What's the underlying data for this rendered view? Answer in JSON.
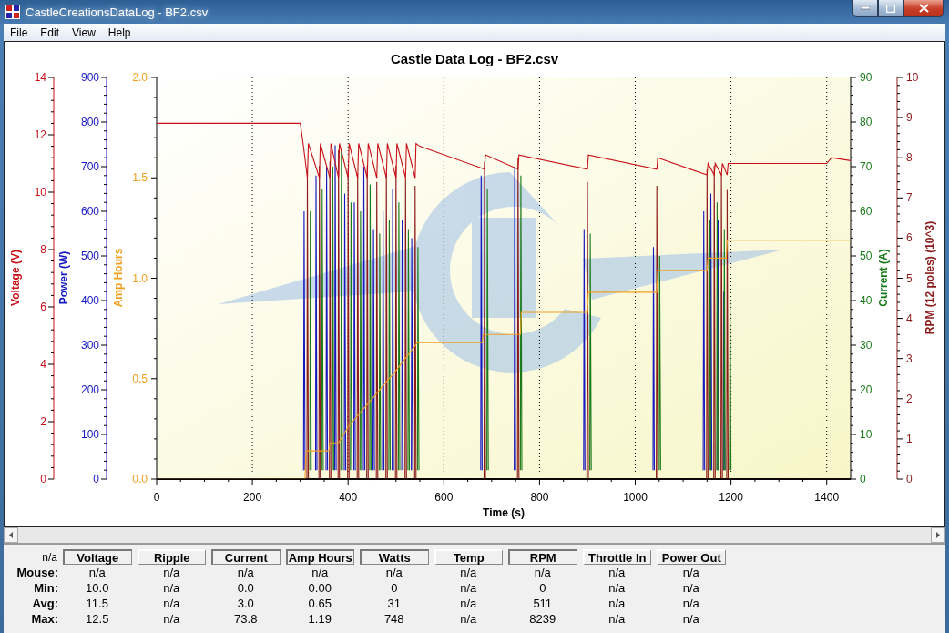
{
  "window": {
    "title": "CastleCreationsDataLog - BF2.csv"
  },
  "menu": [
    "File",
    "Edit",
    "View",
    "Help"
  ],
  "charts": [
    {
      "chart_data": {
        "type": "line",
        "title": "Castle Data Log - BF2.csv",
        "xlabel": "Time (s)",
        "ylabel": "Voltage (V)",
        "xlim": [
          0,
          1450
        ],
        "ylim": [
          0,
          14
        ],
        "xticks": [
          0,
          200,
          400,
          600,
          800,
          1000,
          1200,
          1400
        ],
        "yticks": [
          0,
          2,
          4,
          6,
          8,
          10,
          12,
          14
        ],
        "x": [
          0,
          300,
          306,
          315,
          317,
          340,
          342,
          362,
          364,
          380,
          382,
          400,
          402,
          420,
          422,
          440,
          442,
          460,
          462,
          480,
          482,
          500,
          502,
          520,
          522,
          540,
          542,
          550,
          685,
          687,
          755,
          757,
          900,
          902,
          1045,
          1047,
          1150,
          1152,
          1165,
          1167,
          1180,
          1182,
          1192,
          1194,
          1400,
          1410,
          1450
        ],
        "series": [
          {
            "color": "#c81018",
            "values": [
              12.4,
              12.4,
              11.7,
              10.5,
              11.7,
              10.5,
              11.7,
              10.5,
              11.7,
              10.5,
              11.7,
              10.5,
              11.7,
              10.5,
              11.7,
              10.5,
              11.7,
              10.5,
              11.7,
              10.5,
              11.7,
              10.5,
              11.7,
              10.5,
              11.7,
              10.5,
              11.7,
              11.6,
              10.8,
              11.3,
              10.8,
              11.3,
              10.8,
              11.3,
              10.8,
              11.2,
              10.6,
              11.0,
              10.6,
              11.0,
              10.6,
              11.0,
              10.6,
              11.0,
              11.0,
              11.2,
              11.1
            ]
          }
        ]
      }
    },
    {
      "chart_data": {
        "type": "line",
        "ylabel": "Power (W)",
        "xlim": [
          0,
          1450
        ],
        "ylim": [
          0,
          900
        ],
        "yticks": [
          0,
          100,
          200,
          300,
          400,
          500,
          600,
          700,
          800,
          900
        ],
        "x": [
          307,
          308,
          310,
          311,
          332,
          333,
          335,
          336,
          354,
          355,
          357,
          358,
          372,
          373,
          375,
          376,
          392,
          393,
          395,
          396,
          412,
          413,
          415,
          416,
          432,
          433,
          435,
          436,
          452,
          453,
          455,
          456,
          472,
          473,
          475,
          476,
          492,
          493,
          495,
          496,
          512,
          513,
          515,
          516,
          532,
          533,
          535,
          536,
          677,
          678,
          680,
          681,
          747,
          748,
          750,
          751,
          892,
          893,
          895,
          896,
          1037,
          1038,
          1040,
          1041,
          1142,
          1143,
          1145,
          1146,
          1157,
          1158,
          1160,
          1161,
          1172,
          1173,
          1175,
          1176,
          1184,
          1185,
          1187
        ],
        "series": [
          {
            "color": "#1818c0",
            "values": [
              20,
              600,
              20,
              null,
              20,
              680,
              20,
              null,
              20,
              700,
              20,
              null,
              20,
              748,
              20,
              null,
              20,
              640,
              20,
              null,
              20,
              620,
              20,
              null,
              20,
              700,
              20,
              null,
              20,
              560,
              20,
              null,
              20,
              600,
              20,
              null,
              20,
              650,
              20,
              null,
              20,
              580,
              20,
              null,
              20,
              540,
              20,
              null,
              20,
              680,
              20,
              null,
              20,
              700,
              20,
              null,
              20,
              560,
              20,
              null,
              20,
              520,
              20,
              null,
              20,
              600,
              20,
              null,
              20,
              640,
              20,
              null,
              20,
              580,
              20,
              null,
              20,
              420,
              20
            ]
          }
        ]
      }
    },
    {
      "chart_data": {
        "type": "line",
        "ylabel": "Amp Hours",
        "xlim": [
          0,
          1450
        ],
        "ylim": [
          0,
          2
        ],
        "yticks": [
          {
            "value": 0,
            "label": "0.0"
          },
          {
            "value": 0.5,
            "label": "0.5"
          },
          {
            "value": 1,
            "label": "1.0"
          },
          {
            "value": 1.5,
            "label": "1.5"
          },
          {
            "value": 2,
            "label": "2.0"
          }
        ],
        "x": [
          0,
          310,
          312,
          360,
          362,
          380,
          400,
          450,
          500,
          545,
          680,
          682,
          760,
          762,
          900,
          902,
          1045,
          1047,
          1150,
          1152,
          1190,
          1192,
          1450
        ],
        "series": [
          {
            "color": "#f0a020",
            "values": [
              0,
              0,
              0.14,
              0.14,
              0.18,
              0.18,
              0.26,
              0.4,
              0.54,
              0.68,
              0.68,
              0.72,
              0.72,
              0.83,
              0.83,
              0.93,
              0.93,
              1.04,
              1.04,
              1.1,
              1.1,
              1.19,
              1.19
            ]
          }
        ]
      }
    },
    {
      "chart_data": {
        "type": "line",
        "ylabel": "Current (A)",
        "xlim": [
          0,
          1450
        ],
        "ylim": [
          0,
          90
        ],
        "yticks": [
          0,
          10,
          20,
          30,
          40,
          50,
          60,
          70,
          80,
          90
        ],
        "x": [
          320,
          321,
          323,
          324,
          345,
          346,
          348,
          349,
          367,
          368,
          370,
          371,
          385,
          386,
          388,
          389,
          405,
          406,
          408,
          409,
          425,
          426,
          428,
          429,
          445,
          446,
          448,
          449,
          465,
          466,
          468,
          469,
          485,
          486,
          488,
          489,
          505,
          506,
          508,
          509,
          525,
          526,
          528,
          529,
          545,
          546,
          548,
          549,
          690,
          691,
          693,
          694,
          760,
          761,
          763,
          764,
          905,
          906,
          908,
          909,
          1050,
          1051,
          1053,
          1054,
          1155,
          1156,
          1158,
          1159,
          1170,
          1171,
          1173,
          1174,
          1185,
          1186,
          1188,
          1189,
          1197,
          1198,
          1200
        ],
        "series": [
          {
            "color": "#1a7a1a",
            "values": [
              2,
              60,
              2,
              null,
              2,
              65,
              2,
              null,
              2,
              70,
              2,
              null,
              2,
              73.8,
              2,
              null,
              2,
              62,
              2,
              null,
              2,
              60,
              2,
              null,
              2,
              66,
              2,
              null,
              2,
              55,
              2,
              null,
              2,
              58,
              2,
              null,
              2,
              62,
              2,
              null,
              2,
              56,
              2,
              null,
              2,
              52,
              2,
              null,
              2,
              65,
              2,
              null,
              2,
              68,
              2,
              null,
              2,
              55,
              2,
              null,
              2,
              50,
              2,
              null,
              2,
              58,
              2,
              null,
              2,
              62,
              2,
              null,
              2,
              56,
              2,
              null,
              2,
              40,
              2
            ]
          }
        ]
      }
    },
    {
      "chart_data": {
        "type": "line",
        "ylabel": "RPM (12 poles) (10^3)",
        "xlim": [
          0,
          1450
        ],
        "ylim": [
          0,
          10
        ],
        "yticks": [
          0,
          1,
          2,
          3,
          4,
          5,
          6,
          7,
          8,
          9,
          10
        ],
        "x": [
          314,
          315,
          317,
          339,
          340,
          342,
          361,
          362,
          364,
          379,
          380,
          382,
          399,
          400,
          402,
          419,
          420,
          422,
          439,
          440,
          442,
          459,
          460,
          462,
          479,
          480,
          482,
          499,
          500,
          502,
          519,
          520,
          522,
          539,
          540,
          542,
          684,
          685,
          687,
          754,
          755,
          757,
          899,
          900,
          902,
          1044,
          1045,
          1047,
          1149,
          1150,
          1152,
          1164,
          1165,
          1167,
          1179,
          1180,
          1182,
          1191,
          1192,
          1194,
          1450
        ],
        "series": [
          {
            "color": "#8b1a1a",
            "values": [
              0,
              7.6,
              0,
              0,
              7.8,
              0,
              0,
              7.9,
              0,
              0,
              8.2,
              0,
              0,
              7.7,
              0,
              0,
              7.6,
              0,
              0,
              7.8,
              0,
              0,
              7.4,
              0,
              0,
              7.6,
              0,
              0,
              7.8,
              0,
              0,
              7.5,
              0,
              0,
              7.3,
              0,
              0,
              7.9,
              0,
              0,
              8.0,
              0,
              0,
              7.4,
              0,
              0,
              7.3,
              0,
              0,
              7.7,
              0,
              0,
              7.8,
              0,
              0,
              7.6,
              0,
              0,
              7.2,
              0,
              0
            ]
          }
        ]
      }
    }
  ],
  "stats": {
    "corner": "n/a",
    "columns": [
      {
        "label": "Voltage",
        "selected": true
      },
      {
        "label": "Ripple",
        "selected": false
      },
      {
        "label": "Current",
        "selected": true
      },
      {
        "label": "Amp Hours",
        "selected": true
      },
      {
        "label": "Watts",
        "selected": true
      },
      {
        "label": "Temp",
        "selected": false
      },
      {
        "label": "RPM",
        "selected": true
      },
      {
        "label": "Throttle In",
        "selected": false
      },
      {
        "label": "Power Out",
        "selected": false
      }
    ],
    "rows": [
      {
        "label": "Mouse:",
        "values": [
          "n/a",
          "n/a",
          "n/a",
          "n/a",
          "n/a",
          "n/a",
          "n/a",
          "n/a",
          "n/a"
        ]
      },
      {
        "label": "Min:",
        "values": [
          "10.0",
          "n/a",
          "0.0",
          "0.00",
          "0",
          "n/a",
          "0",
          "n/a",
          "n/a"
        ]
      },
      {
        "label": "Avg:",
        "values": [
          "11.5",
          "n/a",
          "3.0",
          "0.65",
          "31",
          "n/a",
          "511",
          "n/a",
          "n/a"
        ]
      },
      {
        "label": "Max:",
        "values": [
          "12.5",
          "n/a",
          "73.8",
          "1.19",
          "748",
          "n/a",
          "8239",
          "n/a",
          "n/a"
        ]
      }
    ]
  }
}
